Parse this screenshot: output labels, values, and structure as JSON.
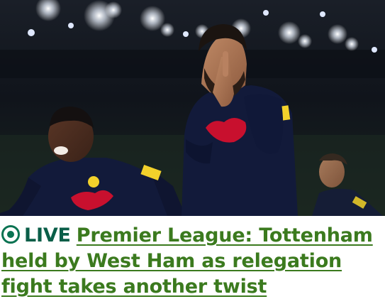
{
  "story": {
    "live_label": "LIVE",
    "headline": "Premier League: Tottenham held by West Ham as relegation fight takes another twist",
    "image_description_icon": "live-indicator-icon"
  },
  "colors": {
    "live_green": "#0a7352",
    "link_green": "#3b7a1e",
    "kit_navy": "#121a3a",
    "kit_yellow": "#f2d12b",
    "sponsor_red": "#c8102e"
  }
}
